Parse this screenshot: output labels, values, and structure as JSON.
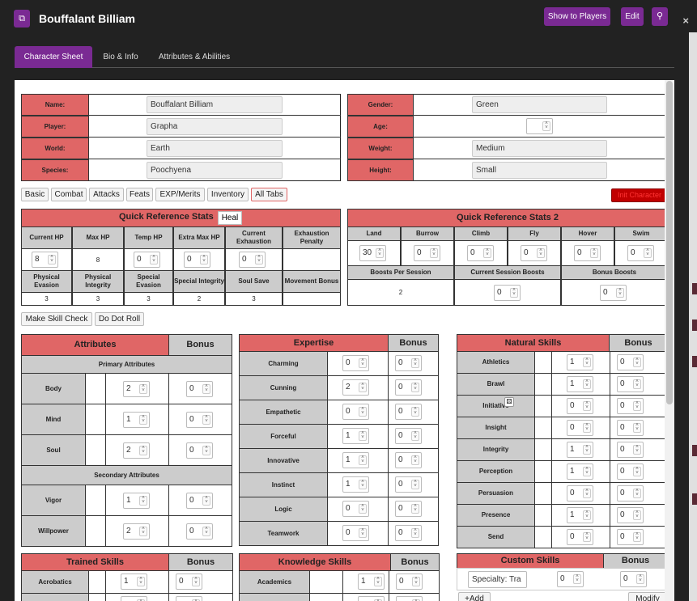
{
  "window": {
    "title": "Bouffalant Billiam",
    "show_players": "Show to Players",
    "edit": "Edit",
    "app_icon": "sheet-icon",
    "search_icon": "search-icon",
    "close_glyph": "×",
    "accent": "#7a2a93"
  },
  "tabs": [
    "Character Sheet",
    "Bio & Info",
    "Attributes & Abilities"
  ],
  "identity": {
    "left": [
      {
        "label": "Name:",
        "value": "Bouffalant Billiam"
      },
      {
        "label": "Player:",
        "value": "Grapha"
      },
      {
        "label": "World:",
        "value": "Earth"
      },
      {
        "label": "Species:",
        "value": "Poochyena"
      }
    ],
    "right": [
      {
        "label": "Gender:",
        "value": "Green"
      },
      {
        "label": "Age:",
        "value": ""
      },
      {
        "label": "Weight:",
        "value": "Medium"
      },
      {
        "label": "Height:",
        "value": "Small"
      }
    ]
  },
  "sheet_tabs": [
    "Basic",
    "Combat",
    "Attacks",
    "Feats",
    "EXP/Merits",
    "Inventory",
    "All Tabs"
  ],
  "init_button": "Init Character",
  "qrs1": {
    "title": "Quick Reference Stats",
    "heal": "Heal",
    "row1_headers": [
      "Current HP",
      "Max HP",
      "Temp HP",
      "Extra Max HP",
      "Current Exhaustion",
      "Exhaustion Penalty"
    ],
    "row1_values": [
      "8",
      "8",
      "0",
      "0",
      "0",
      ""
    ],
    "row2_headers": [
      "Physical Evasion",
      "Physical Integrity",
      "Special Evasion",
      "Special Integrity",
      "Soul Save",
      "Movement Bonus"
    ],
    "row2_values": [
      "3",
      "3",
      "3",
      "2",
      "3",
      ""
    ]
  },
  "qrs2": {
    "title": "Quick Reference Stats 2",
    "headers": [
      "Land",
      "Burrow",
      "Climb",
      "Fly",
      "Hover",
      "Swim"
    ],
    "values": [
      "30",
      "0",
      "0",
      "0",
      "0",
      "0"
    ],
    "boost_headers": [
      "Boosts Per Session",
      "Current Session Boosts",
      "Bonus Boosts"
    ],
    "boost_values": [
      "2",
      "0",
      "0"
    ]
  },
  "actions": {
    "skill_check": "Make Skill Check",
    "dot_roll": "Do Dot Roll"
  },
  "attributes": {
    "title": "Attributes",
    "bonus": "Bonus",
    "primary": "Primary Attributes",
    "secondary": "Secondary Attributes",
    "primary_rows": [
      {
        "name": "Body",
        "value": "2",
        "bonus": "0"
      },
      {
        "name": "Mind",
        "value": "1",
        "bonus": "0"
      },
      {
        "name": "Soul",
        "value": "2",
        "bonus": "0"
      }
    ],
    "secondary_rows": [
      {
        "name": "Vigor",
        "value": "1",
        "bonus": "0"
      },
      {
        "name": "Willpower",
        "value": "2",
        "bonus": "0"
      }
    ]
  },
  "expertise": {
    "title": "Expertise",
    "bonus": "Bonus",
    "rows": [
      {
        "name": "Charming",
        "value": "0",
        "bonus": "0"
      },
      {
        "name": "Cunning",
        "value": "2",
        "bonus": "0"
      },
      {
        "name": "Empathetic",
        "value": "0",
        "bonus": "0"
      },
      {
        "name": "Forceful",
        "value": "1",
        "bonus": "0"
      },
      {
        "name": "Innovative",
        "value": "1",
        "bonus": "0"
      },
      {
        "name": "Instinct",
        "value": "1",
        "bonus": "0"
      },
      {
        "name": "Logic",
        "value": "0",
        "bonus": "0"
      },
      {
        "name": "Teamwork",
        "value": "0",
        "bonus": "0"
      }
    ]
  },
  "natural": {
    "title": "Natural Skills",
    "bonus": "Bonus",
    "rows": [
      {
        "name": "Athletics",
        "value": "1",
        "bonus": "0"
      },
      {
        "name": "Brawl",
        "value": "1",
        "bonus": "0"
      },
      {
        "name": "Initiative",
        "value": "0",
        "bonus": "0"
      },
      {
        "name": "Insight",
        "value": "0",
        "bonus": "0"
      },
      {
        "name": "Integrity",
        "value": "1",
        "bonus": "0"
      },
      {
        "name": "Perception",
        "value": "1",
        "bonus": "0"
      },
      {
        "name": "Persuasion",
        "value": "0",
        "bonus": "0"
      },
      {
        "name": "Presence",
        "value": "1",
        "bonus": "0"
      },
      {
        "name": "Send",
        "value": "0",
        "bonus": "0"
      }
    ]
  },
  "trained": {
    "title": "Trained Skills",
    "bonus": "Bonus",
    "rows": [
      {
        "name": "Acrobatics",
        "value": "1",
        "bonus": "0"
      }
    ]
  },
  "knowledge": {
    "title": "Knowledge Skills",
    "bonus": "Bonus",
    "rows": [
      {
        "name": "Academics",
        "value": "1",
        "bonus": "0"
      }
    ]
  },
  "custom": {
    "title": "Custom Skills",
    "bonus": "Bonus",
    "rows": [
      {
        "name": "Specialty: Tra",
        "value": "0",
        "bonus": "0"
      }
    ],
    "add": "+Add",
    "modify": "Modify"
  }
}
